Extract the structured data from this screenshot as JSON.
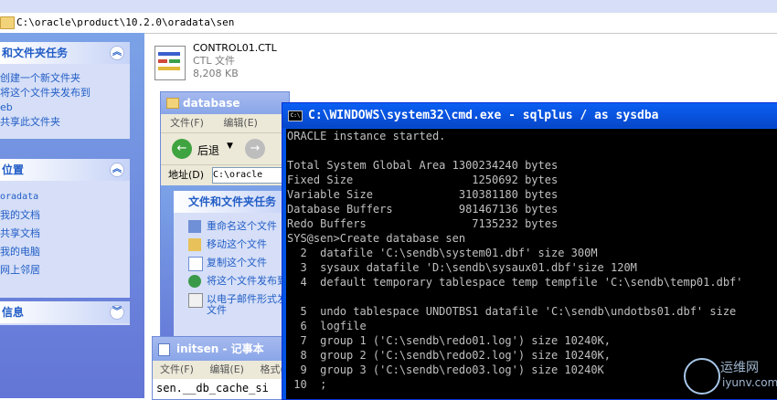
{
  "explorer": {
    "address_path": "C:\\oracle\\product\\10.2.0\\oradata\\sen",
    "file": {
      "name": "CONTROL01.CTL",
      "type": "CTL 文件",
      "size": "8,208 KB"
    },
    "left_panels": [
      {
        "title": "和文件夹任务",
        "chevron": "︽",
        "items": [
          "创建一个新文件夹",
          "将这个文件夹发布到",
          "eb",
          "共享此文件夹"
        ]
      },
      {
        "title": "位置",
        "chevron": "︽",
        "items": [
          "oradata",
          "我的文档",
          "共享文档",
          "我的电脑",
          "网上邻居"
        ]
      },
      {
        "title": "信息",
        "chevron": "︾",
        "items": []
      }
    ]
  },
  "db_window": {
    "title": "database",
    "menu": [
      "文件(F)",
      "编辑(E)"
    ],
    "back_label": "后退",
    "address_label": "地址(D)",
    "address_value": "C:\\oracle",
    "task_title": "文件和文件夹任务",
    "tasks": [
      "重命名这个文件",
      "移动这个文件",
      "复制这个文件",
      "将这个文件发布到",
      "以电子邮件形式发送",
      "文件"
    ]
  },
  "notepad": {
    "title": "initsen - 记事本",
    "menu": [
      "文件(F)",
      "编辑(E)",
      "格式(O)"
    ],
    "line": "sen.__db_cache_si"
  },
  "cmd": {
    "title": "C:\\WINDOWS\\system32\\cmd.exe - sqlplus / as sysdba",
    "lines": [
      "ORACLE instance started.",
      "",
      "Total System Global Area 1300234240 bytes",
      "Fixed Size                  1250692 bytes",
      "Variable Size             310381180 bytes",
      "Database Buffers          981467136 bytes",
      "Redo Buffers                7135232 bytes",
      "SYS@sen>Create database sen",
      "  2  datafile 'C:\\sendb\\system01.dbf' size 300M",
      "  3  sysaux datafile 'D:\\sendb\\sysaux01.dbf'size 120M",
      "  4  default temporary tablespace temp tempfile 'C:\\sendb\\temp01.dbf'",
      "",
      "  5  undo tablespace UNDOTBS1 datafile 'C:\\sendb\\undotbs01.dbf' size",
      "  6  logfile",
      "  7  group 1 ('C:\\sendb\\redo01.log') size 10240K,",
      "  8  group 2 ('C:\\sendb\\redo02.log') size 10240K,",
      "  9  group 3 ('C:\\sendb\\redo03.log') size 10240K",
      " 10  ;"
    ]
  },
  "watermark": {
    "text1": "运维网",
    "text2": "iyunv.com"
  }
}
